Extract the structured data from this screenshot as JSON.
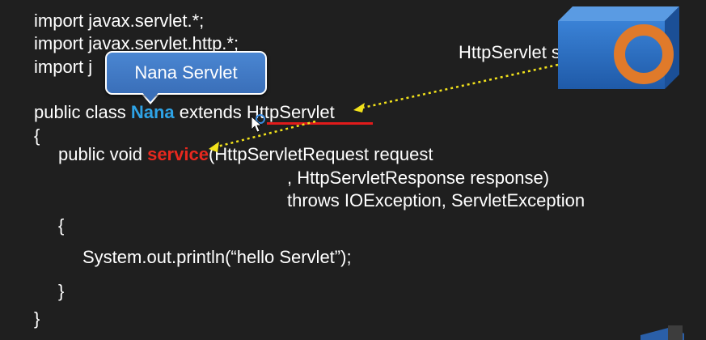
{
  "code": {
    "line1": "import javax.servlet.*;",
    "line2": "import javax.servlet.http.*;",
    "line3": "import j",
    "line4_pre": "public class ",
    "line4_class": "Nana",
    "line4_mid": " extends ",
    "line4_super": "HttpServlet",
    "line5": "{",
    "line6_pre": "public void ",
    "line6_method": "service",
    "line6_post": "(HttpServletRequest request",
    "line7": ", HttpServletResponse response)",
    "line8": "throws IOException, ServletException",
    "line9": "{",
    "line10": "System.out.println(“hello Servlet”);",
    "line11": "}",
    "line12": "}"
  },
  "callout": {
    "text": "Nana Servlet"
  },
  "object_label": "HttpServlet servlet",
  "colors": {
    "background": "#1f1f1f",
    "class_name": "#2ea3e6",
    "method_name": "#e8281e",
    "arrow": "#f2e21b",
    "callout": "#3a6fb9",
    "cube": "#2c6cc0",
    "ring": "#e07a2a"
  },
  "icons": {
    "cube": "cube-object-icon",
    "cursor": "mouse-pointer-icon"
  }
}
